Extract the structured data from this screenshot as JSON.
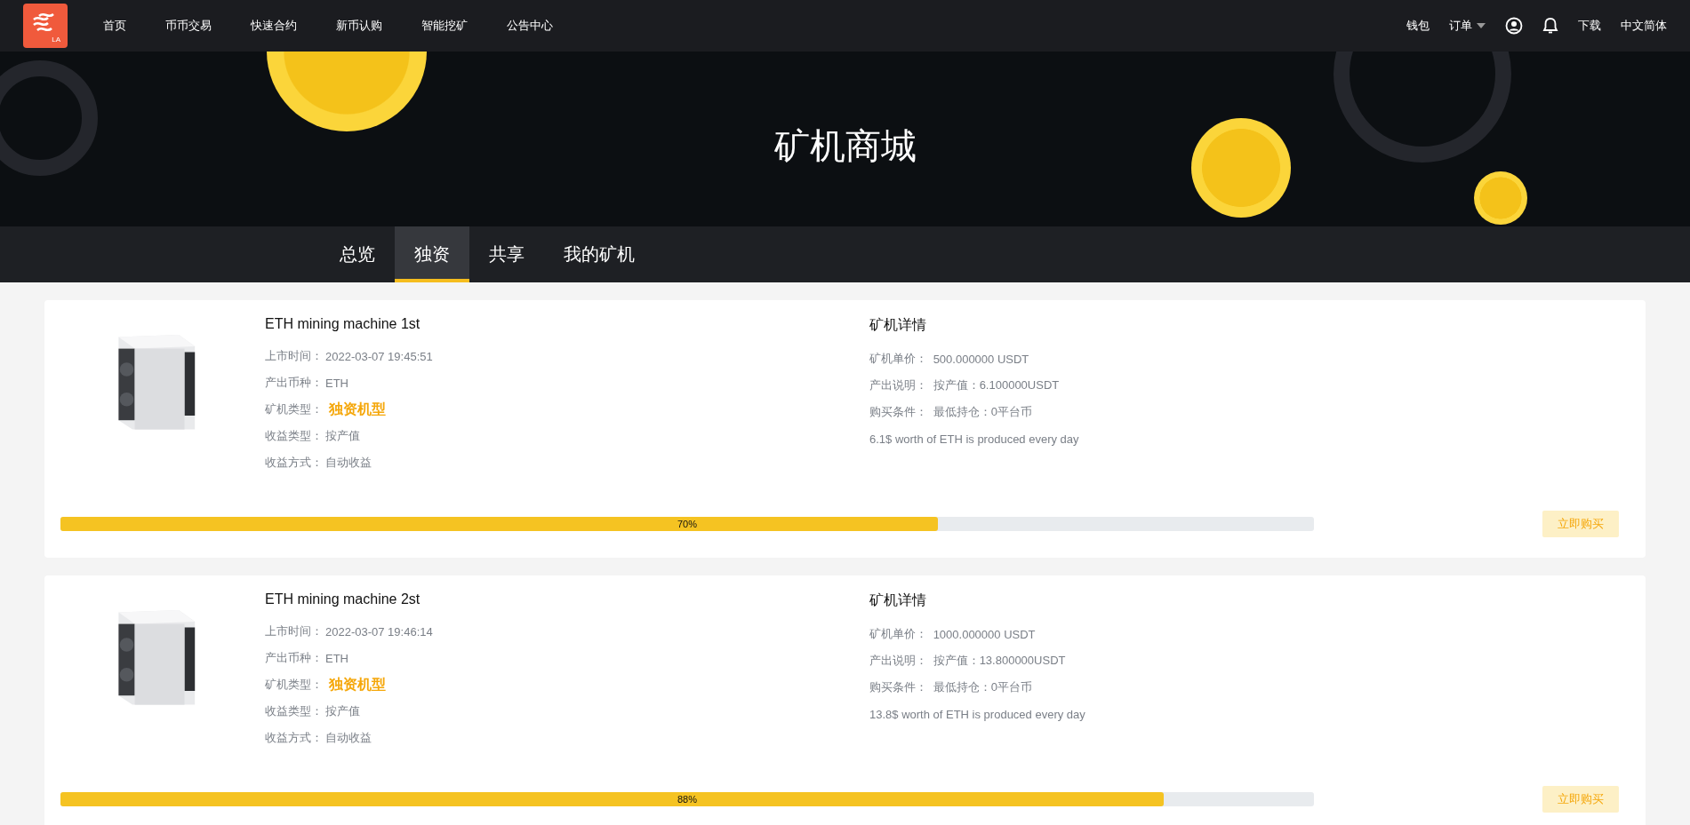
{
  "logo": {
    "text": "LA"
  },
  "nav": {
    "items": [
      "首页",
      "币币交易",
      "快速合约",
      "新币认购",
      "智能挖矿",
      "公告中心"
    ],
    "right": [
      {
        "kind": "link",
        "label": "钱包"
      },
      {
        "kind": "dropdown",
        "label": "订单"
      },
      {
        "kind": "user"
      },
      {
        "kind": "bell"
      },
      {
        "kind": "link",
        "label": "下载"
      },
      {
        "kind": "link",
        "label": "中文简体"
      }
    ]
  },
  "banner": {
    "title": "矿机商城"
  },
  "tabs": [
    {
      "label": "总览",
      "selected": false
    },
    {
      "label": "独资",
      "selected": true
    },
    {
      "label": "共享",
      "selected": false
    },
    {
      "label": "我的矿机",
      "selected": false
    }
  ],
  "machines": [
    {
      "name": "ETH mining machine 1st",
      "fields": [
        {
          "label": "上市时间：",
          "value": "2022-03-07 19:45:51",
          "kind": "plain"
        },
        {
          "label": "产出币种：",
          "value": "ETH",
          "kind": "plain"
        },
        {
          "label": "矿机类型：",
          "value": "独资机型",
          "kind": "highlight"
        },
        {
          "label": "收益类型：",
          "value": "按产值",
          "kind": "plain"
        },
        {
          "label": "收益方式：",
          "value": "自动收益",
          "kind": "plain"
        }
      ],
      "details_title": "矿机详情",
      "details": [
        {
          "label": "矿机单价：",
          "value": "500.000000 USDT"
        },
        {
          "label": "产出说明：",
          "value": "按产值：6.100000USDT"
        },
        {
          "label": "购买条件：",
          "value": "最低持仓：0平台币"
        }
      ],
      "note": "6.1$ worth of ETH is produced every day",
      "level": 0.7,
      "percent": "70%",
      "buy": "立即购买"
    },
    {
      "name": "ETH mining machine 2st",
      "fields": [
        {
          "label": "上市时间：",
          "value": "2022-03-07 19:46:14",
          "kind": "plain"
        },
        {
          "label": "产出币种：",
          "value": "ETH",
          "kind": "plain"
        },
        {
          "label": "矿机类型：",
          "value": "独资机型",
          "kind": "highlight"
        },
        {
          "label": "收益类型：",
          "value": "按产值",
          "kind": "plain"
        },
        {
          "label": "收益方式：",
          "value": "自动收益",
          "kind": "plain"
        }
      ],
      "details_title": "矿机详情",
      "details": [
        {
          "label": "矿机单价：",
          "value": "1000.000000 USDT"
        },
        {
          "label": "产出说明：",
          "value": "按产值：13.800000USDT"
        },
        {
          "label": "购买条件：",
          "value": "最低持仓：0平台币"
        }
      ],
      "note": "13.8$ worth of ETH is produced every day",
      "level": 0.88,
      "percent": "88%",
      "buy": "立即购买"
    }
  ]
}
